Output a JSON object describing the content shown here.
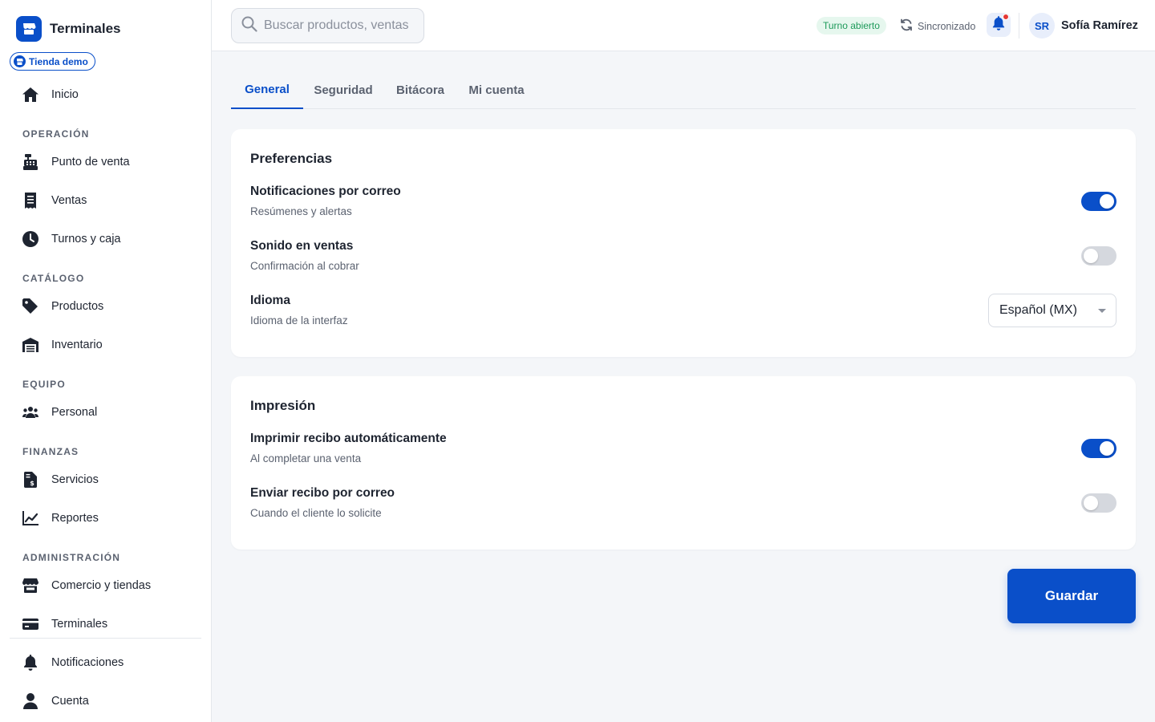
{
  "app": {
    "name": "Terminales",
    "store_chip": "Tienda demo"
  },
  "sidebar": {
    "home": {
      "label": "Inicio",
      "icon": "home-icon"
    },
    "sections": [
      {
        "title": "OPERACIÓN",
        "items": [
          {
            "label": "Punto de venta",
            "icon": "cash-register-icon"
          },
          {
            "label": "Ventas",
            "icon": "receipt-icon"
          },
          {
            "label": "Turnos y caja",
            "icon": "clock-icon"
          }
        ]
      },
      {
        "title": "CATÁLOGO",
        "items": [
          {
            "label": "Productos",
            "icon": "tag-icon"
          },
          {
            "label": "Inventario",
            "icon": "warehouse-icon"
          }
        ]
      },
      {
        "title": "EQUIPO",
        "items": [
          {
            "label": "Personal",
            "icon": "users-icon"
          }
        ]
      },
      {
        "title": "FINANZAS",
        "items": [
          {
            "label": "Servicios",
            "icon": "invoice-dollar-icon"
          },
          {
            "label": "Reportes",
            "icon": "chart-line-icon"
          }
        ]
      },
      {
        "title": "ADMINISTRACIÓN",
        "items": [
          {
            "label": "Comercio y tiendas",
            "icon": "store-icon"
          },
          {
            "label": "Terminales",
            "icon": "credit-card-icon"
          }
        ]
      }
    ],
    "footer": [
      {
        "label": "Notificaciones",
        "icon": "bell-icon"
      },
      {
        "label": "Cuenta",
        "icon": "user-icon"
      }
    ]
  },
  "header": {
    "search_placeholder": "Buscar productos, ventas",
    "shift_status": "Turno abierto",
    "sync_status": "Sincronizado",
    "user_initials": "SR",
    "user_name": "Sofía Ramírez"
  },
  "tabs": [
    "General",
    "Seguridad",
    "Bitácora",
    "Mi cuenta"
  ],
  "active_tab": "General",
  "preferences": {
    "title": "Preferencias",
    "rows": [
      {
        "label": "Notificaciones por correo",
        "sub": "Resúmenes y alertas",
        "enabled": true
      },
      {
        "label": "Sonido en ventas",
        "sub": "Confirmación al cobrar",
        "enabled": false
      }
    ],
    "language": {
      "label": "Idioma",
      "sub": "Idioma de la interfaz",
      "value": "Español (MX)"
    }
  },
  "printing": {
    "title": "Impresión",
    "rows": [
      {
        "label": "Imprimir recibo automáticamente",
        "sub": "Al completar una venta",
        "enabled": true
      },
      {
        "label": "Enviar recibo por correo",
        "sub": "Cuando el cliente lo solicite",
        "enabled": false
      }
    ]
  },
  "save_label": "Guardar",
  "colors": {
    "accent": "#0a4fc9",
    "success": "#1e9a5a",
    "alert": "#e53935"
  }
}
